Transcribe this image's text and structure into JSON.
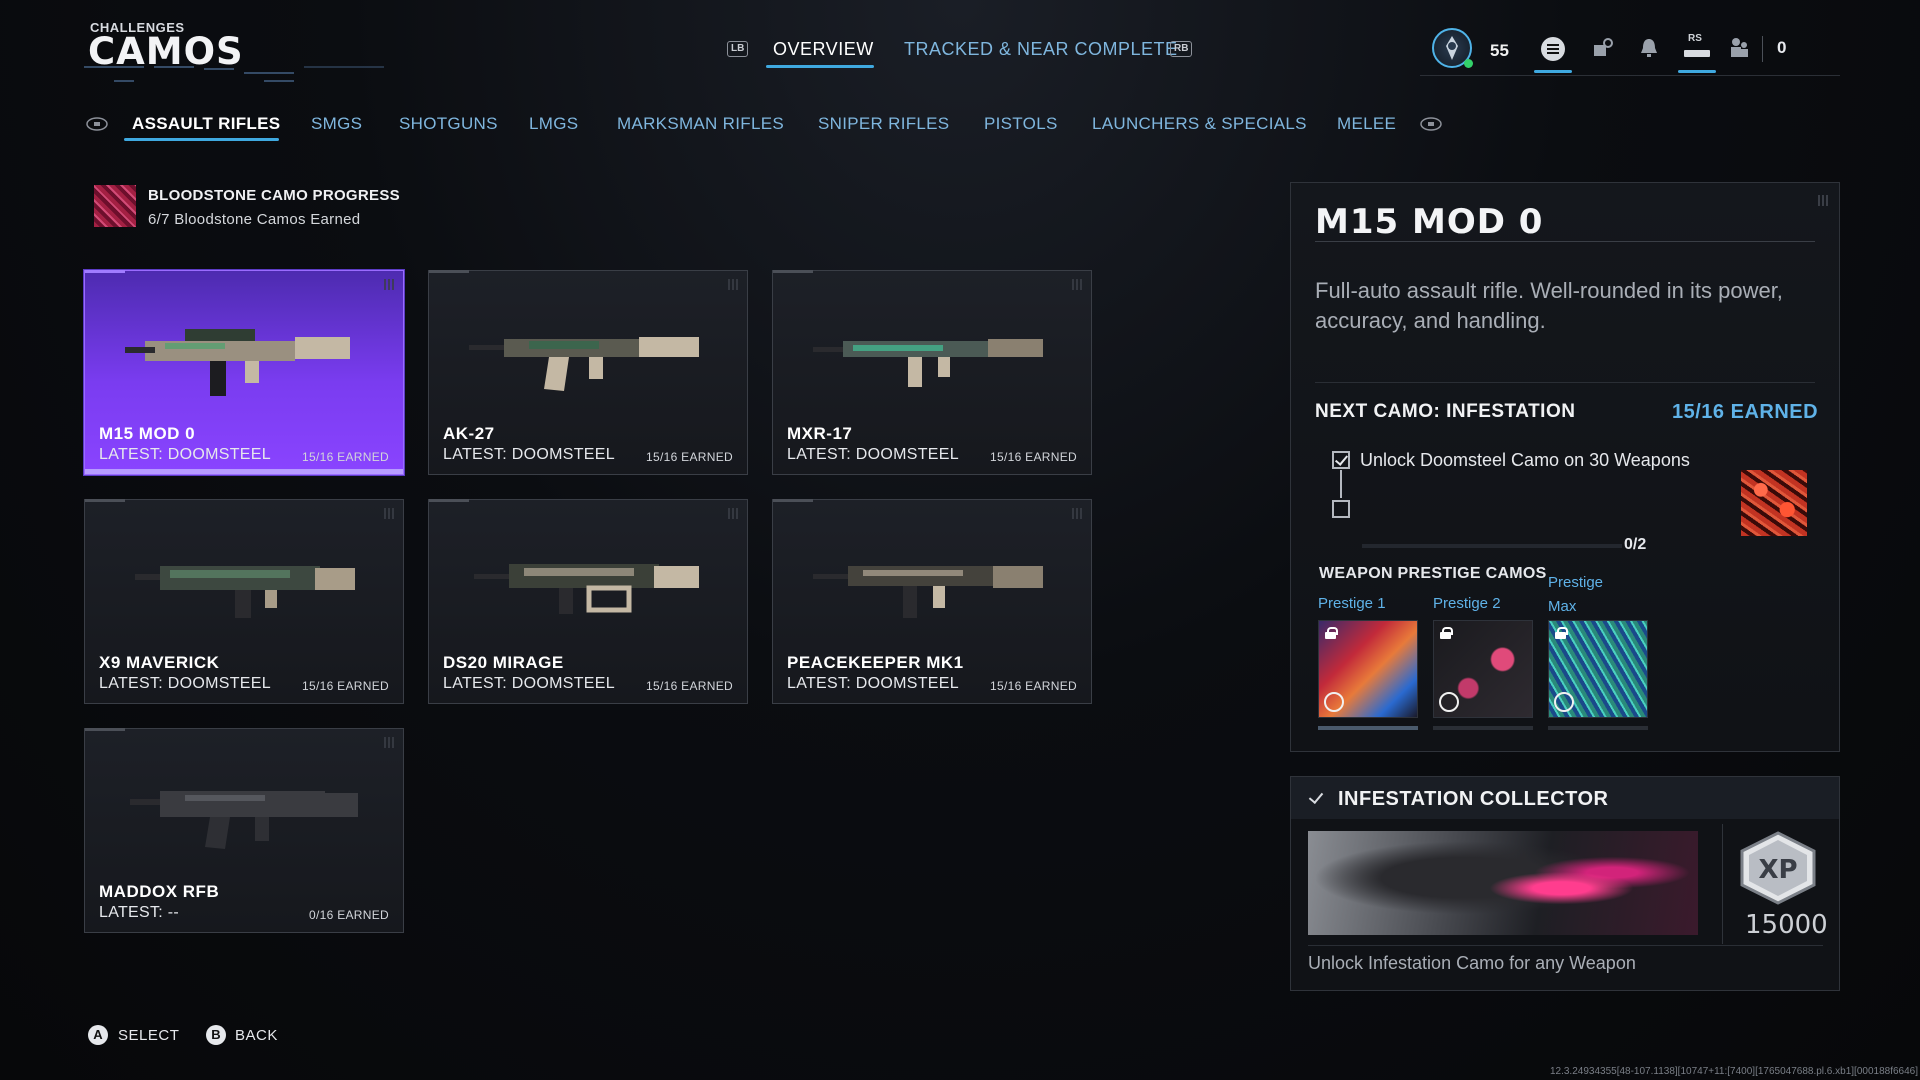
{
  "header": {
    "section": "CHALLENGES",
    "title": "CAMOS",
    "lb": "LB",
    "rb": "RB",
    "tabs": [
      "OVERVIEW",
      "TRACKED & NEAR COMPLETE"
    ],
    "level": "55",
    "rs": "RS",
    "currency": "0",
    "accent": "#3fa9e0"
  },
  "categories": [
    "ASSAULT RIFLES",
    "SMGS",
    "SHOTGUNS",
    "LMGS",
    "MARKSMAN RIFLES",
    "SNIPER RIFLES",
    "PISTOLS",
    "LAUNCHERS & SPECIALS",
    "MELEE"
  ],
  "progress": {
    "title": "BLOODSTONE CAMO PROGRESS",
    "subtitle": "6/7 Bloodstone Camos Earned"
  },
  "weapons": [
    {
      "name": "M15 MOD 0",
      "latest": "LATEST: DOOMSTEEL",
      "earned": "15/16 EARNED",
      "selected": true
    },
    {
      "name": "AK-27",
      "latest": "LATEST: DOOMSTEEL",
      "earned": "15/16 EARNED"
    },
    {
      "name": "MXR-17",
      "latest": "LATEST: DOOMSTEEL",
      "earned": "15/16 EARNED"
    },
    {
      "name": "X9 MAVERICK",
      "latest": "LATEST: DOOMSTEEL",
      "earned": "15/16 EARNED"
    },
    {
      "name": "DS20 MIRAGE",
      "latest": "LATEST: DOOMSTEEL",
      "earned": "15/16 EARNED"
    },
    {
      "name": "PEACEKEEPER MK1",
      "latest": "LATEST: DOOMSTEEL",
      "earned": "15/16 EARNED"
    },
    {
      "name": "MADDOX RFB",
      "latest": "LATEST: --",
      "earned": "0/16 EARNED"
    }
  ],
  "detail": {
    "name": "M15 MOD 0",
    "description": "Full-auto assault rifle. Well-rounded in its power, accuracy, and handling.",
    "next_camo": "NEXT CAMO: INFESTATION",
    "next_earned": "15/16 EARNED",
    "requirement": "Unlock Doomsteel Camo on 30 Weapons",
    "requirement_count": "0/2",
    "prestige_title": "WEAPON PRESTIGE CAMOS",
    "prestige": [
      "Prestige 1",
      "Prestige 2",
      "Prestige Max"
    ]
  },
  "collector": {
    "title": "INFESTATION COLLECTOR",
    "xp_label": "XP",
    "xp_value": "15000",
    "description": "Unlock Infestation Camo for any Weapon"
  },
  "footer": {
    "select_key": "A",
    "select_label": "SELECT",
    "back_key": "B",
    "back_label": "BACK",
    "build": "12.3.24934355[48-107.1138][10747+11:[7400][1765047688.pl.6.xb1][000188f6646]"
  }
}
